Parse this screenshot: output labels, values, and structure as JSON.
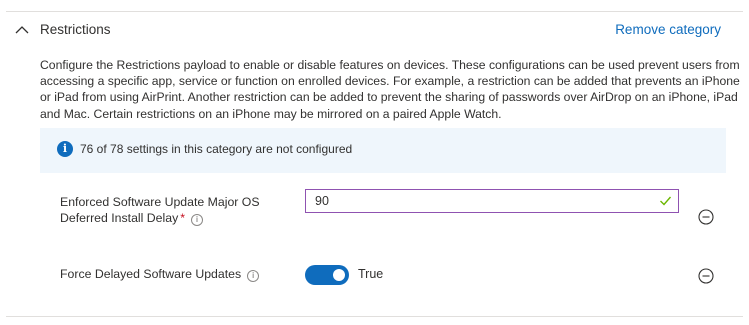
{
  "section": {
    "title": "Restrictions",
    "remove_label": "Remove category",
    "description": "Configure the Restrictions payload to enable or disable features on devices. These configurations can be used prevent users from accessing a specific app, service or function on enrolled devices. For example, a restriction can be added that prevents an iPhone or iPad from using AirPrint. Another restriction can be added to prevent the sharing of passwords over AirDrop on an iPhone, iPad and Mac. Certain restrictions on an iPhone may be mirrored on a paired Apple Watch."
  },
  "banner": {
    "icon": "info-icon",
    "text": "76 of 78 settings in this category are not configured"
  },
  "settings": [
    {
      "label": "Enforced Software Update Major OS Deferred Install Delay",
      "required": "*",
      "value": "90",
      "valid": true
    },
    {
      "label": "Force Delayed Software Updates",
      "toggle_on": true,
      "toggle_text": "True"
    }
  ],
  "colors": {
    "accent": "#0f6cbd",
    "input_border": "#8f52b1",
    "valid_check": "#6bb700",
    "required": "#c50f1f",
    "banner_bg": "#eff6fc"
  }
}
